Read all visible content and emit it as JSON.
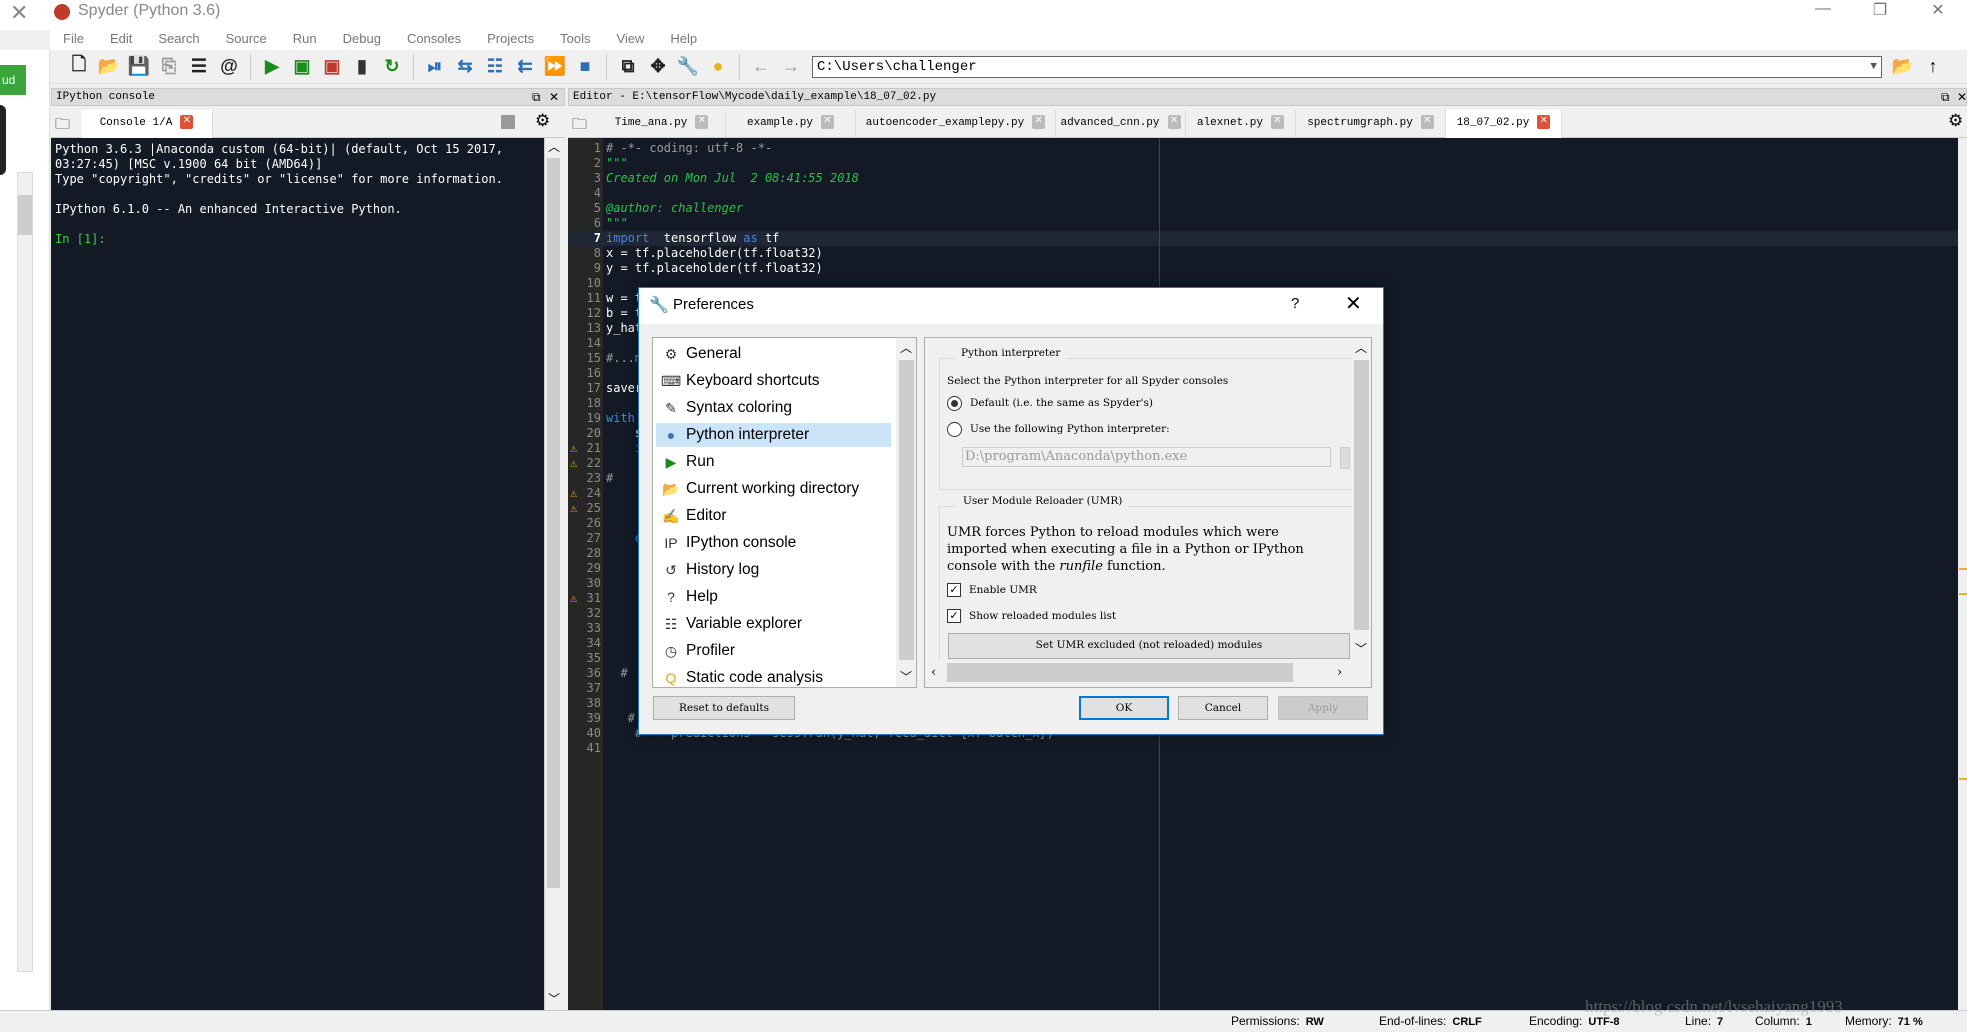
{
  "window": {
    "title": "Spyder (Python 3.6)",
    "controls": [
      "—",
      "❐",
      "✕"
    ]
  },
  "menu": [
    "File",
    "Edit",
    "Search",
    "Source",
    "Run",
    "Debug",
    "Consoles",
    "Projects",
    "Tools",
    "View",
    "Help"
  ],
  "toolbar": {
    "groups": [
      [
        {
          "icon": "new-file-icon",
          "g": "🗋",
          "c": "#222"
        },
        {
          "icon": "open-folder-icon",
          "g": "📂",
          "c": "#222"
        },
        {
          "icon": "save-icon",
          "g": "💾",
          "c": "#999"
        },
        {
          "icon": "save-all-icon",
          "g": "⎘",
          "c": "#999"
        },
        {
          "icon": "outline-list-icon",
          "g": "☰",
          "c": "#222"
        },
        {
          "icon": "at-icon",
          "g": "@",
          "c": "#222"
        }
      ],
      [
        {
          "icon": "run-icon",
          "g": "▶",
          "c": "#1a8c1a"
        },
        {
          "icon": "run-cell-icon",
          "g": "▣",
          "c": "#1a8c1a"
        },
        {
          "icon": "run-cell-advance-icon",
          "g": "▣",
          "c": "#c0392b"
        },
        {
          "icon": "run-selection-icon",
          "g": "▮",
          "c": "#333"
        },
        {
          "icon": "rerun-icon",
          "g": "↻",
          "c": "#1a8c1a"
        }
      ],
      [
        {
          "icon": "debug-icon",
          "g": "⏯",
          "c": "#2d6fb5"
        },
        {
          "icon": "step-icon",
          "g": "⇆",
          "c": "#2d6fb5"
        },
        {
          "icon": "step-into-icon",
          "g": "☷",
          "c": "#2d6fb5"
        },
        {
          "icon": "step-return-icon",
          "g": "⇇",
          "c": "#2d6fb5"
        },
        {
          "icon": "continue-icon",
          "g": "⏩",
          "c": "#2d6fb5"
        },
        {
          "icon": "stop-debug-icon",
          "g": "■",
          "c": "#2d6fb5"
        }
      ],
      [
        {
          "icon": "maximize-pane-icon",
          "g": "⧉",
          "c": "#222"
        },
        {
          "icon": "fullscreen-icon",
          "g": "✥",
          "c": "#222"
        },
        {
          "icon": "wrench-icon",
          "g": "🔧",
          "c": "#222"
        },
        {
          "icon": "python-path-icon",
          "g": "●",
          "c": "#e8b31e"
        }
      ],
      [
        {
          "icon": "back-arrow-icon",
          "g": "←",
          "c": "#999"
        },
        {
          "icon": "forward-arrow-icon",
          "g": "→",
          "c": "#999"
        }
      ]
    ],
    "path": "C:\\Users\\challenger"
  },
  "left_strip": {
    "button_label": "ud"
  },
  "console_pane": {
    "header": "IPython console",
    "tab": "Console 1/A",
    "lines": [
      "Python 3.6.3 |Anaconda custom (64-bit)| (default, Oct 15 2017,",
      "03:27:45) [MSC v.1900 64 bit (AMD64)]",
      "Type \"copyright\", \"credits\" or \"license\" for more information.",
      "",
      "IPython 6.1.0 -- An enhanced Interactive Python.",
      ""
    ],
    "prompt": "In [1]:"
  },
  "editor_pane": {
    "header": "Editor - E:\\tensorFlow\\Mycode\\daily_example\\18_07_02.py",
    "tabs": [
      "Time_ana.py",
      "example.py",
      "autoencoder_examplepy.py",
      "advanced_cnn.py",
      "alexnet.py",
      "spectrumgraph.py",
      "18_07_02.py"
    ],
    "active_tab": "18_07_02.py",
    "current_line": 7,
    "lines": [
      {
        "n": 1,
        "parts": [
          [
            "c-com",
            "# -*- coding: utf-8 -*-"
          ]
        ]
      },
      {
        "n": 2,
        "parts": [
          [
            "c-str",
            "\"\"\""
          ]
        ]
      },
      {
        "n": 3,
        "parts": [
          [
            "c-str",
            "Created on Mon Jul  2 08:41:55 2018"
          ]
        ]
      },
      {
        "n": 4,
        "parts": []
      },
      {
        "n": 5,
        "parts": [
          [
            "c-str",
            "@author: challenger"
          ]
        ]
      },
      {
        "n": 6,
        "parts": [
          [
            "c-str",
            "\"\"\""
          ]
        ]
      },
      {
        "n": 7,
        "parts": [
          [
            "c-kw",
            "import"
          ],
          [
            "",
            "  tensorflow "
          ],
          [
            "c-kw",
            "as"
          ],
          [
            "",
            " tf"
          ]
        ]
      },
      {
        "n": 8,
        "parts": [
          [
            "",
            "x = tf.placeholder(tf.float32)"
          ]
        ]
      },
      {
        "n": 9,
        "parts": [
          [
            "",
            "y = tf.placeholder(tf.float32)"
          ]
        ]
      },
      {
        "n": 10,
        "parts": []
      },
      {
        "n": 11,
        "parts": [
          [
            "",
            "w = t"
          ]
        ]
      },
      {
        "n": 12,
        "parts": [
          [
            "",
            "b = t"
          ]
        ]
      },
      {
        "n": 13,
        "parts": [
          [
            "",
            "y_hat"
          ]
        ]
      },
      {
        "n": 14,
        "parts": []
      },
      {
        "n": 15,
        "parts": [
          [
            "c-com",
            "#...m"
          ]
        ]
      },
      {
        "n": 16,
        "parts": []
      },
      {
        "n": 17,
        "parts": [
          [
            "",
            "saver"
          ]
        ]
      },
      {
        "n": 18,
        "parts": []
      },
      {
        "n": 19,
        "parts": [
          [
            "c-kw",
            "with"
          ]
        ]
      },
      {
        "n": 20,
        "parts": [
          [
            "",
            "    s"
          ]
        ]
      },
      {
        "n": 21,
        "parts": [
          [
            "c-kw",
            "    i"
          ]
        ],
        "warn": true
      },
      {
        "n": 22,
        "parts": [],
        "warn": true
      },
      {
        "n": 23,
        "parts": [
          [
            "c-com",
            "#"
          ]
        ]
      },
      {
        "n": 24,
        "parts": [],
        "warn": true
      },
      {
        "n": 25,
        "parts": [],
        "warn": true
      },
      {
        "n": 26,
        "parts": []
      },
      {
        "n": 27,
        "parts": [
          [
            "c-kw",
            "    e"
          ]
        ]
      },
      {
        "n": 28,
        "parts": []
      },
      {
        "n": 29,
        "parts": []
      },
      {
        "n": 30,
        "parts": []
      },
      {
        "n": 31,
        "parts": [],
        "warn": true
      },
      {
        "n": 32,
        "parts": []
      },
      {
        "n": 33,
        "parts": []
      },
      {
        "n": 34,
        "parts": []
      },
      {
        "n": 35,
        "parts": []
      },
      {
        "n": 36,
        "parts": [
          [
            "c-com",
            "  #"
          ]
        ]
      },
      {
        "n": 37,
        "parts": []
      },
      {
        "n": 38,
        "parts": []
      },
      {
        "n": 39,
        "parts": [
          [
            "c-com",
            "   #"
          ]
        ]
      },
      {
        "n": 40,
        "parts": [
          [
            "c-com",
            "    #    predictions = sess.run(y_hat, feed_dict={x: batch_x})"
          ]
        ]
      },
      {
        "n": 41,
        "parts": []
      }
    ]
  },
  "status_bar": {
    "permissions_label": "Permissions:",
    "permissions": "RW",
    "eol_label": "End-of-lines:",
    "eol": "CRLF",
    "encoding_label": "Encoding:",
    "encoding": "UTF-8",
    "line_label": "Line:",
    "line": "7",
    "column_label": "Column:",
    "column": "1",
    "memory_label": "Memory:",
    "memory": "71 %",
    "watermark": "https://blog.csdn.net/lvsehaiyang1993"
  },
  "preferences": {
    "title": "Preferences",
    "help": "?",
    "close": "✕",
    "categories": [
      {
        "label": "General",
        "icon": "gears-icon",
        "g": "⚙"
      },
      {
        "label": "Keyboard shortcuts",
        "icon": "keyboard-icon",
        "g": "⌨"
      },
      {
        "label": "Syntax coloring",
        "icon": "eyedropper-icon",
        "g": "✎"
      },
      {
        "label": "Python interpreter",
        "icon": "python-icon",
        "g": "●",
        "selected": true
      },
      {
        "label": "Run",
        "icon": "run-icon",
        "g": "▶"
      },
      {
        "label": "Current working directory",
        "icon": "folder-open-icon",
        "g": "📂"
      },
      {
        "label": "Editor",
        "icon": "edit-icon",
        "g": "✍"
      },
      {
        "label": "IPython console",
        "icon": "ipython-icon",
        "g": "IP"
      },
      {
        "label": "History log",
        "icon": "history-icon",
        "g": "↺"
      },
      {
        "label": "Help",
        "icon": "help-icon",
        "g": "?"
      },
      {
        "label": "Variable explorer",
        "icon": "table-icon",
        "g": "☷"
      },
      {
        "label": "Profiler",
        "icon": "clock-icon",
        "g": "◷"
      },
      {
        "label": "Static code analysis",
        "icon": "magnifier-icon",
        "g": "Q"
      }
    ],
    "interpreter_group": "Python interpreter",
    "select_text": "Select the Python interpreter for all Spyder consoles",
    "radio_default": "Default (i.e. the same as Spyder's)",
    "radio_custom": "Use the following Python interpreter:",
    "radio_selected": "default",
    "interpreter_path": "D:\\program\\Anaconda\\python.exe",
    "umr_group": "User Module Reloader (UMR)",
    "umr_text_1": "UMR forces Python to reload modules which were",
    "umr_text_2": "imported when executing a file in a Python or IPython",
    "umr_text_3a": "console with the ",
    "umr_text_3b": "runfile",
    "umr_text_3c": " function.",
    "enable_umr": "Enable UMR",
    "enable_umr_checked": true,
    "show_reloaded": "Show reloaded modules list",
    "show_reloaded_checked": true,
    "umr_excluded_button": "Set UMR excluded (not reloaded) modules",
    "reset": "Reset to defaults",
    "ok": "OK",
    "cancel": "Cancel",
    "apply": "Apply"
  }
}
